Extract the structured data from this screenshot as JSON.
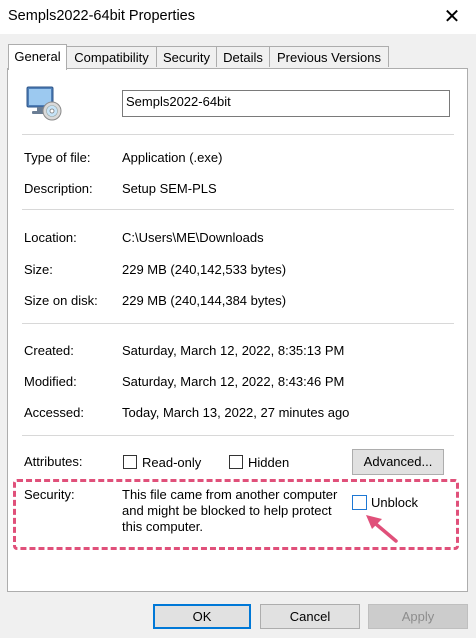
{
  "window": {
    "title": "Sempls2022-64bit Properties",
    "close_glyph": "✕"
  },
  "tabs": [
    {
      "label": "General",
      "active": true
    },
    {
      "label": "Compatibility"
    },
    {
      "label": "Security"
    },
    {
      "label": "Details"
    },
    {
      "label": "Previous Versions"
    }
  ],
  "file": {
    "name": "Sempls2022-64bit",
    "icon": "application-installer-icon"
  },
  "properties": {
    "type_label": "Type of file:",
    "type_value": "Application (.exe)",
    "description_label": "Description:",
    "description_value": "Setup SEM-PLS",
    "location_label": "Location:",
    "location_value": "C:\\Users\\ME\\Downloads",
    "size_label": "Size:",
    "size_value": "229 MB (240,142,533 bytes)",
    "size_on_disk_label": "Size on disk:",
    "size_on_disk_value": "229 MB (240,144,384 bytes)",
    "created_label": "Created:",
    "created_value": "Saturday, March 12, 2022, 8:35:13 PM",
    "modified_label": "Modified:",
    "modified_value": "Saturday, March 12, 2022, 8:43:46 PM",
    "accessed_label": "Accessed:",
    "accessed_value": "Today, March 13, 2022, 27 minutes ago"
  },
  "attributes": {
    "label": "Attributes:",
    "read_only_label": "Read-only",
    "read_only_checked": false,
    "hidden_label": "Hidden",
    "hidden_checked": false,
    "advanced_button": "Advanced..."
  },
  "security": {
    "label": "Security:",
    "message_line1": "This file came from another computer",
    "message_line2": "and might be blocked to help protect",
    "message_line3": "this computer.",
    "unblock_label": "Unblock",
    "unblock_checked": false,
    "highlight_color": "#e0507a"
  },
  "footer": {
    "ok_label": "OK",
    "cancel_label": "Cancel",
    "apply_label": "Apply",
    "apply_enabled": false
  },
  "colors": {
    "accent": "#0078d7",
    "annotation": "#e0507a"
  }
}
